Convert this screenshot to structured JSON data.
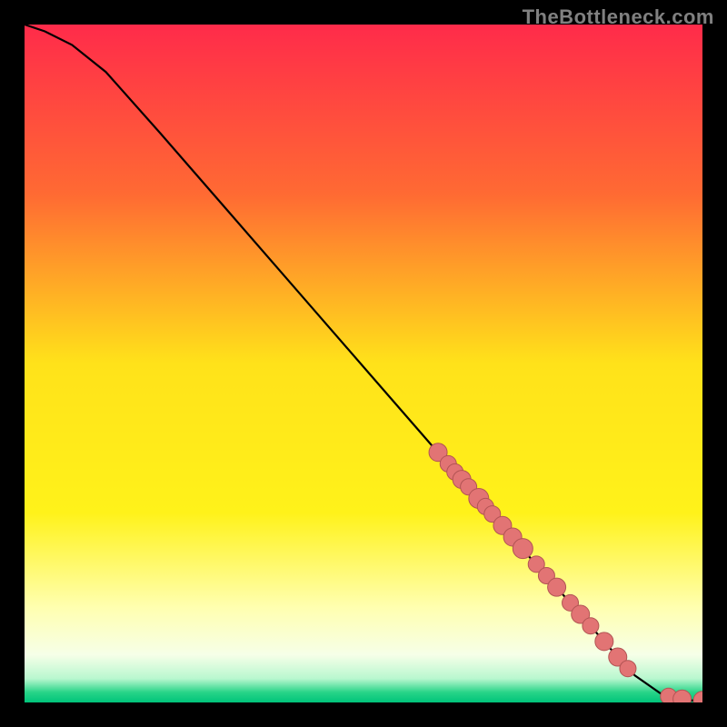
{
  "watermark": "TheBottleneck.com",
  "chart_data": {
    "type": "line",
    "title": "",
    "xlabel": "",
    "ylabel": "",
    "xlim": [
      0,
      100
    ],
    "ylim": [
      0,
      100
    ],
    "grid": false,
    "legend": false,
    "gradient_stops": [
      {
        "offset": 0.0,
        "color": "#ff2b4a"
      },
      {
        "offset": 0.25,
        "color": "#ff6a33"
      },
      {
        "offset": 0.5,
        "color": "#ffe21a"
      },
      {
        "offset": 0.72,
        "color": "#fff21a"
      },
      {
        "offset": 0.86,
        "color": "#ffffb0"
      },
      {
        "offset": 0.93,
        "color": "#f6ffe8"
      },
      {
        "offset": 0.965,
        "color": "#b8f7cf"
      },
      {
        "offset": 0.985,
        "color": "#28d488"
      },
      {
        "offset": 1.0,
        "color": "#00c47a"
      }
    ],
    "series": [
      {
        "name": "bottleneck-curve",
        "type": "line",
        "x": [
          0,
          3,
          7,
          12,
          20,
          30,
          40,
          50,
          60,
          66,
          70,
          74,
          78,
          82,
          86,
          90,
          94,
          96,
          98,
          100
        ],
        "y": [
          100,
          99,
          97,
          93,
          84,
          72.5,
          61,
          49.5,
          38,
          31.2,
          26.6,
          22,
          17.5,
          13,
          8.4,
          4,
          1.2,
          0.5,
          0.3,
          0.3
        ]
      },
      {
        "name": "sample-points",
        "type": "scatter",
        "x": [
          61,
          62.5,
          63.5,
          64.5,
          65.5,
          67,
          68,
          69,
          70.5,
          72,
          73.5,
          75.5,
          77,
          78.5,
          80.5,
          82,
          83.5,
          85.5,
          87.5,
          89,
          95,
          97,
          100
        ],
        "y": [
          36.9,
          35.2,
          34.0,
          32.9,
          31.8,
          30.1,
          28.9,
          27.8,
          26.1,
          24.4,
          22.7,
          20.4,
          18.7,
          17.0,
          14.7,
          13.0,
          11.3,
          9.0,
          6.7,
          5.0,
          0.9,
          0.5,
          0.3
        ],
        "size": [
          10,
          9,
          9,
          10,
          9,
          11,
          9,
          9,
          10,
          10,
          11,
          9,
          9,
          10,
          9,
          10,
          9,
          10,
          10,
          9,
          9,
          10,
          10
        ]
      }
    ],
    "colors": {
      "line": "#000000",
      "point_fill": "#e27474",
      "point_stroke": "#b25454"
    }
  }
}
